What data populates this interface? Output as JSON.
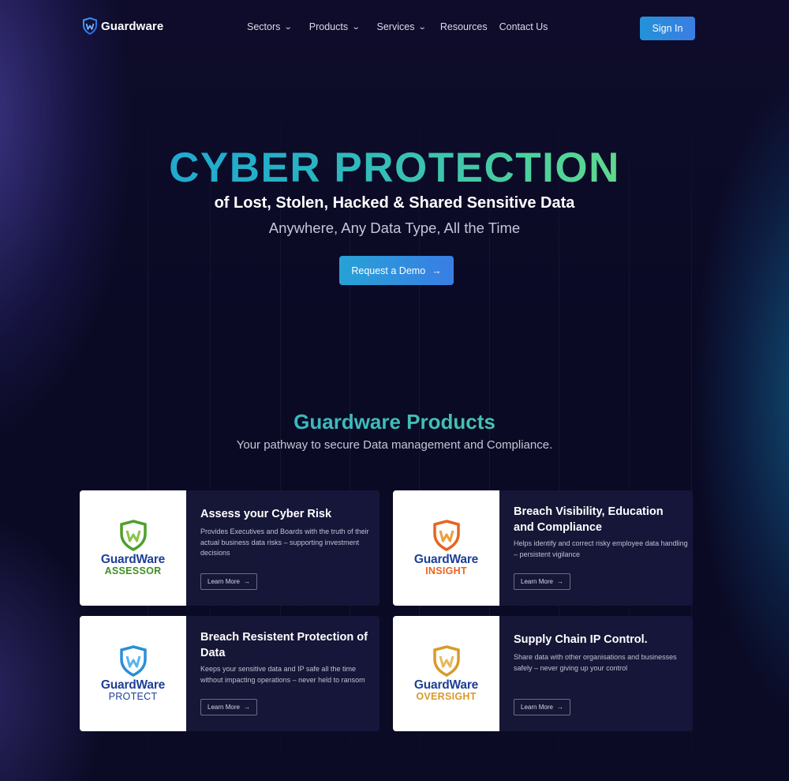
{
  "header": {
    "logo_text": "Guardware",
    "nav": [
      {
        "label": "Sectors",
        "has_dropdown": true
      },
      {
        "label": "Products",
        "has_dropdown": true
      },
      {
        "label": "Services",
        "has_dropdown": true
      },
      {
        "label": "Resources",
        "has_dropdown": false
      },
      {
        "label": "Contact Us",
        "has_dropdown": false
      }
    ],
    "sign_in_label": "Sign In"
  },
  "hero": {
    "title": "CYBER PROTECTION",
    "subtitle": "of Lost, Stolen, Hacked & Shared Sensitive Data",
    "tagline": "Anywhere, Any Data Type, All the Time",
    "cta_label": "Request a Demo",
    "cta_icon": "arrow-right-icon"
  },
  "products": {
    "title": "Guardware Products",
    "subtitle": "Your pathway to secure Data management and Compliance.",
    "cards": [
      {
        "brand": "GuardWare",
        "product": "ASSESSOR",
        "brand_color": "#1d3f96",
        "accent_color": "#4f9f2c",
        "heading": "Assess your Cyber Risk",
        "description": "Provides Executives and Boards with the truth of their actual business data risks – supporting investment decisions",
        "button_label": "Learn More"
      },
      {
        "brand": "GuardWare",
        "product": "INSIGHT",
        "brand_color": "#1d3f96",
        "accent_color": "#e8641f",
        "heading": "Breach Visibility, Education and Compliance",
        "description": "Helps identify and correct risky employee data handling – persistent vigilance",
        "button_label": "Learn More"
      },
      {
        "brand": "GuardWare",
        "product": "PROTECT",
        "brand_color": "#1d3f96",
        "accent_color": "#2a8fd8",
        "heading": "Breach Resistent Protection of Data",
        "description": "Keeps your sensitive data and IP safe all the time without impacting operations – never held to ransom",
        "button_label": "Learn More"
      },
      {
        "brand": "GuardWare",
        "product": "OVERSIGHT",
        "brand_color": "#1d3f96",
        "accent_color": "#d89a2b",
        "heading": "Supply Chain IP Control.",
        "description": "Share data with other organisations and businesses safely – never giving up your control",
        "button_label": "Learn More"
      }
    ]
  }
}
